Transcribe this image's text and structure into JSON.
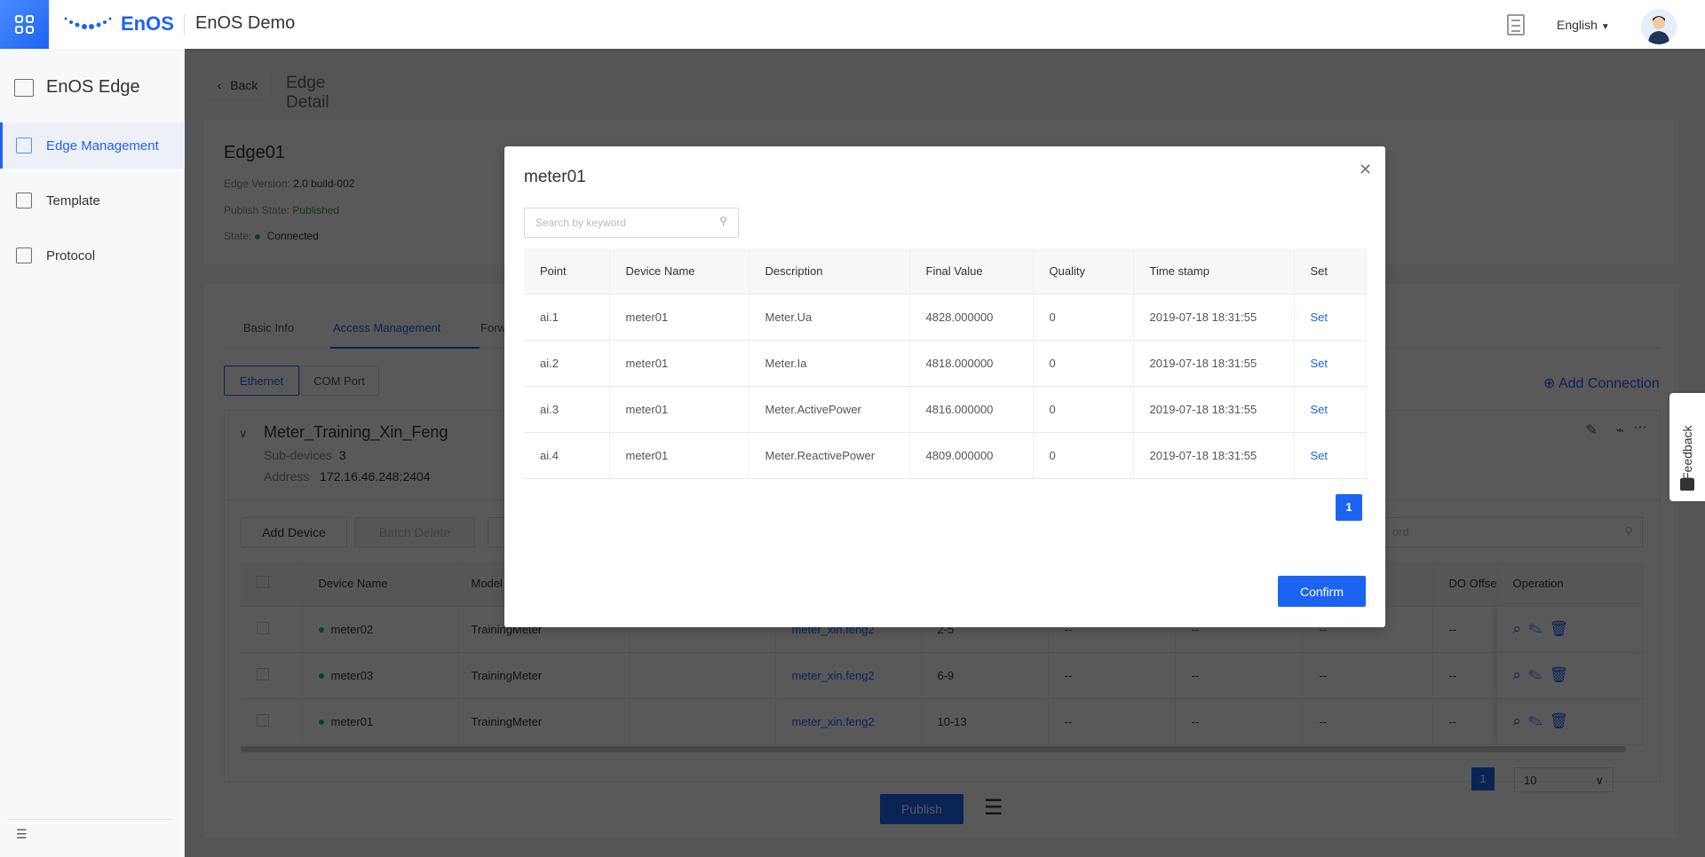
{
  "header": {
    "brand": "EnOS",
    "app_name": "EnOS Demo",
    "language": "English"
  },
  "sidebar": {
    "title": "EnOS Edge",
    "items": [
      {
        "label": "Edge Management",
        "active": true
      },
      {
        "label": "Template"
      },
      {
        "label": "Protocol"
      }
    ]
  },
  "page": {
    "back": "Back",
    "title": "Edge Detail"
  },
  "edge": {
    "name": "Edge01",
    "version_label": "Edge Version:",
    "version": "2.0 build-002",
    "publish_label": "Publish State:",
    "publish": "Published",
    "state_label": "State:",
    "state": "Connected"
  },
  "tabs": [
    "Basic Info",
    "Access Management",
    "Forw"
  ],
  "segments": [
    "Ethernet",
    "COM Port"
  ],
  "add_connection": "Add Connection",
  "connection": {
    "name": "Meter_Training_Xin_Feng",
    "subdevices_label": "Sub-devices",
    "subdevices": "3",
    "address_label": "Address",
    "address": "172.16.46.248:2404"
  },
  "device_toolbar": {
    "add": "Add Device",
    "batch_delete": "Batch Delete",
    "search_placeholder": "ord"
  },
  "device_table": {
    "headers": [
      "Device Name",
      "Model",
      "DO Offse",
      "Operation"
    ],
    "rows": [
      {
        "name": "meter02",
        "model": "TrainingMeter",
        "link": "meter_xin.feng2",
        "range": "2-5",
        "c1": "--",
        "c2": "--",
        "c3": "--",
        "c4": "--"
      },
      {
        "name": "meter03",
        "model": "TrainingMeter",
        "link": "meter_xin.feng2",
        "range": "6-9",
        "c1": "--",
        "c2": "--",
        "c3": "--",
        "c4": "--"
      },
      {
        "name": "meter01",
        "model": "TrainingMeter",
        "link": "meter_xin.feng2",
        "range": "10-13",
        "c1": "--",
        "c2": "--",
        "c3": "--",
        "c4": "--"
      }
    ],
    "page": "1",
    "page_size": "10"
  },
  "footer": {
    "publish": "Publish"
  },
  "modal": {
    "title": "meter01",
    "search_placeholder": "Search by keyword",
    "headers": [
      "Point",
      "Device Name",
      "Description",
      "Final Value",
      "Quality",
      "Time stamp",
      "Set"
    ],
    "rows": [
      [
        "ai.1",
        "meter01",
        "Meter.Ua",
        "4828.000000",
        "0",
        "2019-07-18 18:31:55",
        "Set"
      ],
      [
        "ai.2",
        "meter01",
        "Meter.Ia",
        "4818.000000",
        "0",
        "2019-07-18 18:31:55",
        "Set"
      ],
      [
        "ai.3",
        "meter01",
        "Meter.ActivePower",
        "4816.000000",
        "0",
        "2019-07-18 18:31:55",
        "Set"
      ],
      [
        "ai.4",
        "meter01",
        "Meter.ReactivePower",
        "4809.000000",
        "0",
        "2019-07-18 18:31:55",
        "Set"
      ]
    ],
    "page": "1",
    "confirm": "Confirm"
  },
  "feedback": "Feedback",
  "colors": {
    "primary": "#1c63f2",
    "success": "#2e9e3e",
    "connected": "#14b8a6"
  }
}
